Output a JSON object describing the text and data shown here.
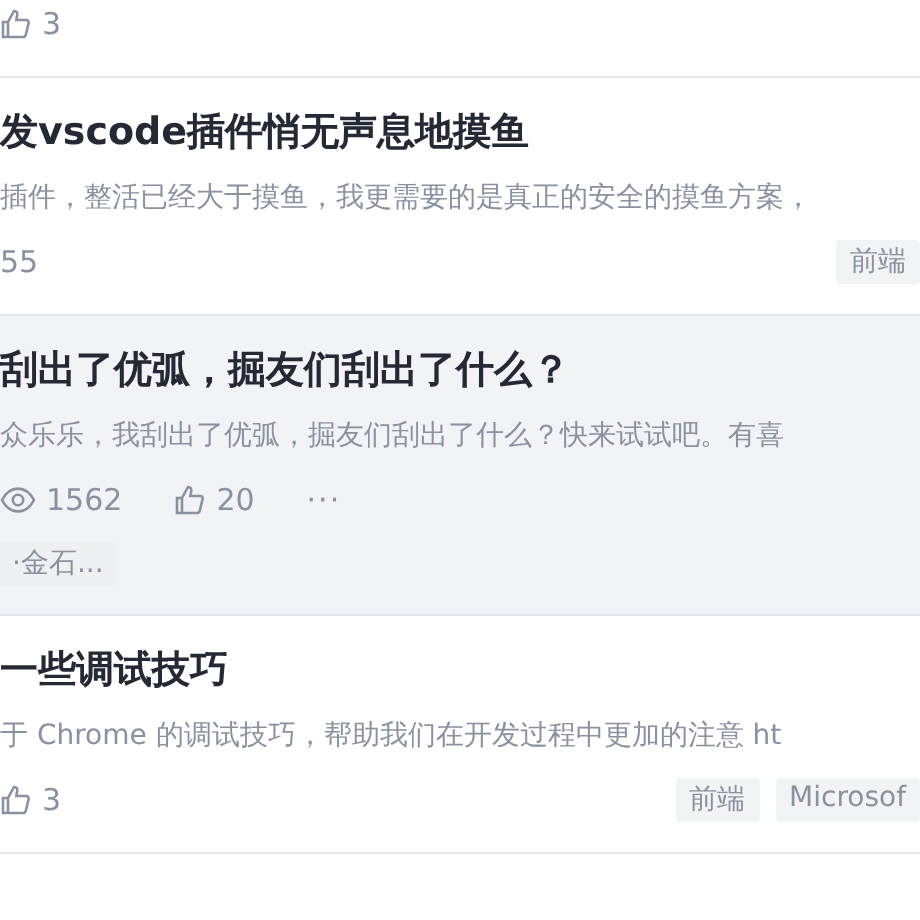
{
  "articles": [
    {
      "hovered": false,
      "meta": [
        {
          "kind": "likes",
          "text": "3"
        }
      ]
    },
    {
      "hovered": false,
      "title": "发vscode插件悄无声息地摸鱼",
      "excerpt": "插件，整活已经大于摸鱼，我更需要的是真正的安全的摸鱼方案，",
      "meta": [
        {
          "kind": "plain",
          "text": "55"
        }
      ],
      "tags": [
        "前端"
      ]
    },
    {
      "hovered": true,
      "title": "刮出了优弧，掘友们刮出了什么？",
      "excerpt": "众乐乐，我刮出了优弧，掘友们刮出了什么？快来试试吧。有喜",
      "meta": [
        {
          "kind": "views",
          "text": "1562"
        },
        {
          "kind": "likes",
          "text": "20"
        },
        {
          "kind": "more",
          "text": "···"
        }
      ],
      "sub_tags": [
        "·金石..."
      ]
    },
    {
      "hovered": false,
      "title": "一些调试技巧",
      "excerpt": "于 Chrome 的调试技巧，帮助我们在开发过程中更加的注意 ht",
      "meta": [
        {
          "kind": "likes",
          "text": "3"
        }
      ],
      "tags": [
        "前端",
        "Microsof"
      ]
    }
  ]
}
